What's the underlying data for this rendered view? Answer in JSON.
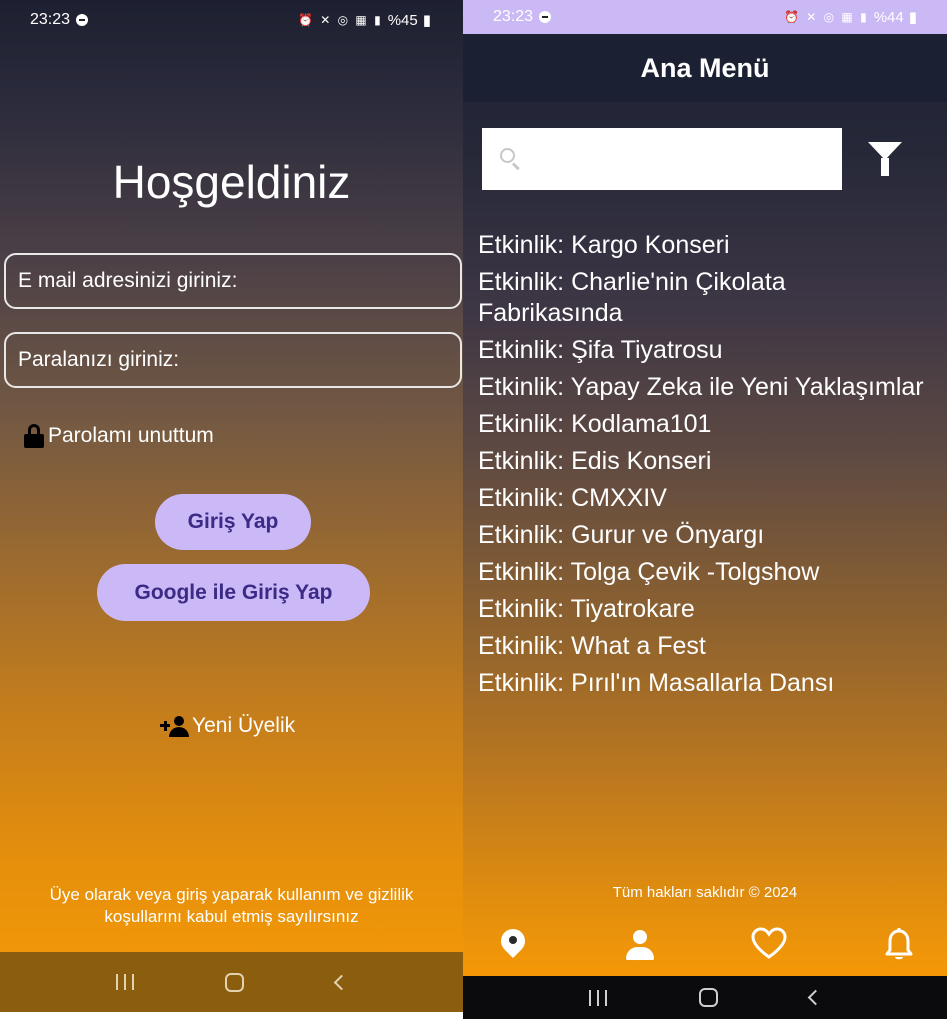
{
  "login_screen": {
    "status_bar": {
      "time": "23:23",
      "battery": "%45"
    },
    "title": "Hoşgeldiniz",
    "email_placeholder": "E mail adresinizi giriniz:",
    "password_placeholder": "Paralanızı giriniz:",
    "forgot_password": "Parolamı unuttum",
    "login_button": "Giriş Yap",
    "google_login_button": "Google ile Giriş Yap",
    "new_member": "Yeni Üyelik",
    "terms_line1": "Üye olarak veya giriş yaparak kullanım ve gizlilik",
    "terms_line2": "koşullarını kabul etmiş sayılırsınız"
  },
  "menu_screen": {
    "status_bar": {
      "time": "23:23",
      "battery": "%44"
    },
    "title": "Ana Menü",
    "search_placeholder": "",
    "events": [
      "Etkinlik: Kargo Konseri",
      "Etkinlik: Charlie'nin Çikolata Fabrikasında",
      "Etkinlik: Şifa Tiyatrosu",
      "Etkinlik: Yapay Zeka ile Yeni Yaklaşımlar",
      "Etkinlik: Kodlama101",
      "Etkinlik: Edis Konseri",
      "Etkinlik: CMXXIV",
      "Etkinlik: Gurur ve Önyargı",
      "Etkinlik: Tolga Çevik -Tolgshow",
      "Etkinlik: Tiyatrokare",
      "Etkinlik: What a Fest",
      "Etkinlik: Pırıl'ın Masallarla Dansı"
    ],
    "copyright": "Tüm hakları saklıdır © 2024",
    "bottom_nav": [
      "location-pin-icon",
      "person-icon",
      "heart-icon",
      "bell-icon"
    ]
  },
  "colors": {
    "accent_button": "#cbb8f7",
    "button_text": "#3b2a86",
    "appbar": "#1b2033",
    "gradient_bottom": "#f09608"
  }
}
